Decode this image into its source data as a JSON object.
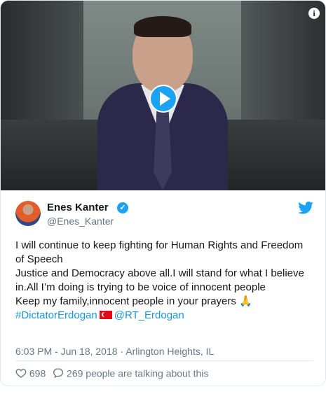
{
  "media": {
    "play_icon": "play-icon",
    "info_icon": "info-icon",
    "info_label": "i"
  },
  "author": {
    "name": "Enes Kanter",
    "handle": "@Enes_Kanter",
    "verified_icon": "verified-badge-icon",
    "verified_glyph": "✓"
  },
  "tweet": {
    "line1": "I will continue to keep fighting for Human Rights and Freedom of Speech",
    "line2": "Justice and Democracy above all.I will stand for what I believe in.All I’m doing is trying to be voice of innocent people",
    "line3": "Keep my family,innocent people in your prayers 🙏",
    "hashtag": "#DictatorErdogan",
    "flag_icon": "turkey-flag-icon",
    "mention": "@RT_Erdogan"
  },
  "meta": {
    "time": "6:03 PM - Jun 18, 2018",
    "separator": "·",
    "place": "Arlington Heights, IL"
  },
  "actions": {
    "likes": "698",
    "talking": "269 people are talking about this"
  },
  "colors": {
    "link": "#1b95e0",
    "brand": "#1da1f2",
    "text": "#14171a",
    "muted": "#657786"
  }
}
